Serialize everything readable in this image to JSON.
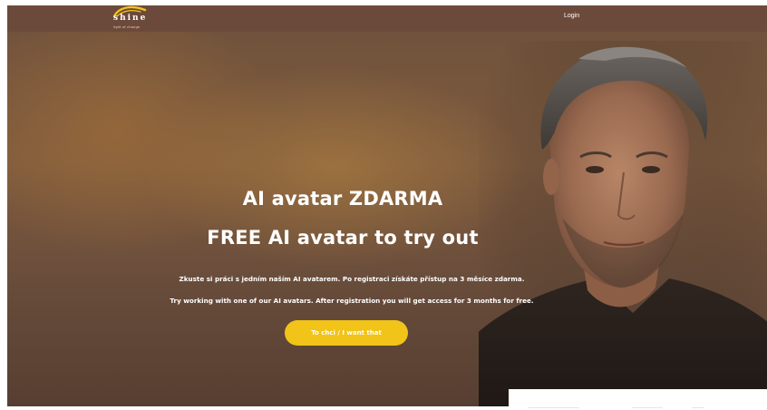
{
  "header": {
    "logo": {
      "word": "shine",
      "tagline": "light of change"
    },
    "login_label": "Login"
  },
  "hero": {
    "title_line_1": "AI avatar ZDARMA",
    "title_line_2": "FREE AI avatar to try out",
    "text_cz": "Zkuste si práci s jedním naším AI avatarem. Po registraci získáte přístup na 3 měsíce zdarma.",
    "text_en": "Try working with one of our AI avatars. After registration you will get access for 3 months for free.",
    "cta_label": "To chci / I want that"
  },
  "colors": {
    "header_bg": "#6b4a3b",
    "accent": "#f2c318",
    "text": "#ffffff"
  }
}
